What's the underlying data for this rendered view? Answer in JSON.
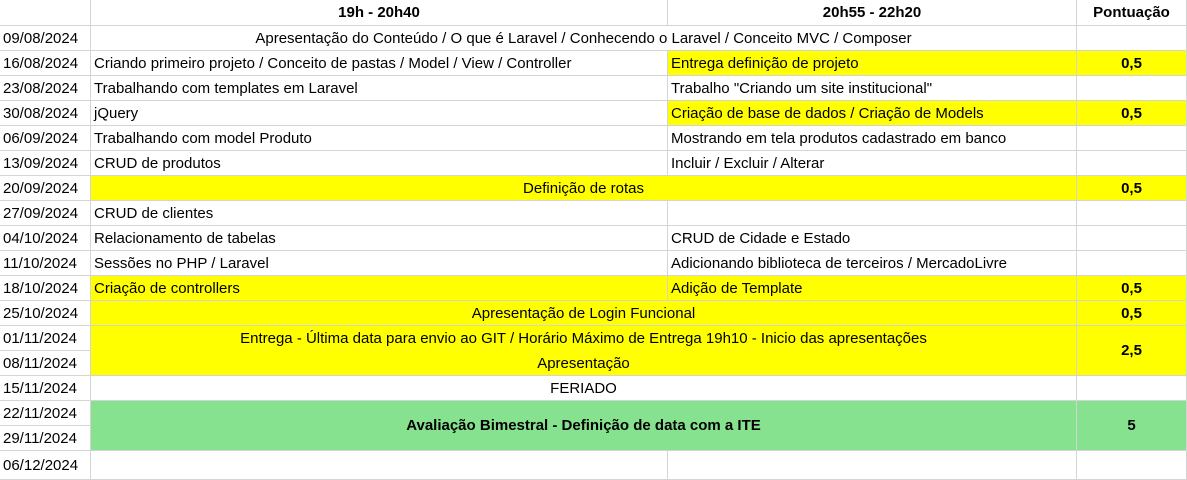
{
  "header": {
    "date": "",
    "col1": "19h - 20h40",
    "col2": "20h55 - 22h20",
    "score": "Pontuação"
  },
  "colors": {
    "yellow": "#ffff00",
    "green": "#86e28e",
    "grid": "#d4d4d4"
  },
  "rows": [
    {
      "date": "09/08/2024",
      "merged": "Apresentação do Conteúdo / O que é Laravel / Conhecendo o Laravel / Conceito MVC / Composer",
      "score": ""
    },
    {
      "date": "16/08/2024",
      "col1": "Criando primeiro projeto / Conceito de pastas / Model / View / Controller",
      "col2": "Entrega definição de projeto",
      "score": "0,5"
    },
    {
      "date": "23/08/2024",
      "col1": "Trabalhando com templates em Laravel",
      "col2": "Trabalho \"Criando um site institucional\"",
      "score": ""
    },
    {
      "date": "30/08/2024",
      "col1": "jQuery",
      "col2": "Criação de base de dados / Criação de Models",
      "score": "0,5"
    },
    {
      "date": "06/09/2024",
      "col1": "Trabalhando com model Produto",
      "col2": "Mostrando em tela produtos cadastrado em banco",
      "score": ""
    },
    {
      "date": "13/09/2024",
      "col1": "CRUD de produtos",
      "col2": "Incluir / Excluir / Alterar",
      "score": ""
    },
    {
      "date": "20/09/2024",
      "merged": "Definição de rotas",
      "score": "0,5"
    },
    {
      "date": "27/09/2024",
      "col1": "CRUD de clientes",
      "col2": "",
      "score": ""
    },
    {
      "date": "04/10/2024",
      "col1": "Relacionamento de tabelas",
      "col2": "CRUD de Cidade e Estado",
      "score": ""
    },
    {
      "date": "11/10/2024",
      "col1": "Sessões no PHP / Laravel",
      "col2": "Adicionando biblioteca de terceiros / MercadoLivre",
      "score": ""
    },
    {
      "date": "18/10/2024",
      "col1": "Criação de controllers",
      "col2": "Adição de Template",
      "score": "0,5"
    },
    {
      "date": "25/10/2024",
      "merged": "Apresentação de Login Funcional",
      "score": "0,5"
    },
    {
      "date": "01/11/2024",
      "merged": "Entrega - Última data para envio ao GIT / Horário Máximo de Entrega 19h10 - Inicio das apresentações"
    },
    {
      "date": "08/11/2024",
      "merged": "Apresentação"
    },
    {
      "date": "15/11/2024",
      "merged": "FERIADO",
      "score": ""
    },
    {
      "date": "22/11/2024",
      "merged": "Avaliação Bimestral - Definição de data com a ITE",
      "score": "5"
    },
    {
      "date": "29/11/2024"
    },
    {
      "date": "06/12/2024",
      "col1": "",
      "col2": "",
      "score": ""
    }
  ],
  "merged_score_0111": "2,5"
}
